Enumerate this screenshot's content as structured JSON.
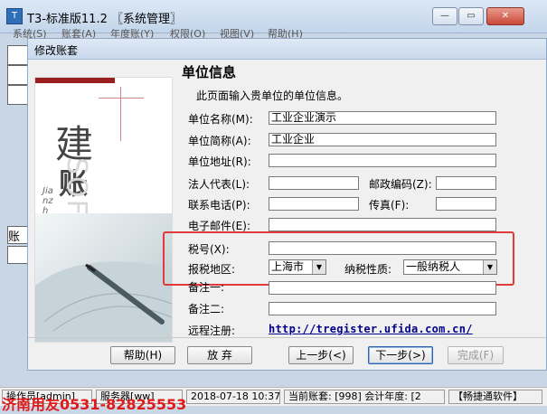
{
  "app": {
    "title": "T3-标准版11.2 〖系统管理〗",
    "icon": "T",
    "window_controls": {
      "minimize": "—",
      "maximize": "▭",
      "close": "✕"
    }
  },
  "menu": [
    {
      "label": "系统(S)"
    },
    {
      "label": "账套(A)"
    },
    {
      "label": "年度账(Y)"
    },
    {
      "label": "权限(O)"
    },
    {
      "label": "视图(V)"
    },
    {
      "label": "帮助(H)"
    }
  ],
  "background": {
    "row_label": "账"
  },
  "dialog": {
    "title": "修改账套",
    "panel": {
      "char1": "建",
      "char2": "账",
      "pinyin": "Jianzhang",
      "soft": "SOF"
    },
    "heading": "单位信息",
    "intro": "此页面输入贵单位的单位信息。",
    "fields": {
      "company_name": {
        "label": "单位名称(M):",
        "value": "工业企业演示"
      },
      "short_name": {
        "label": "单位简称(A):",
        "value": "工业企业"
      },
      "address": {
        "label": "单位地址(R):",
        "value": ""
      },
      "legal_rep": {
        "label": "法人代表(L):",
        "value": ""
      },
      "postcode": {
        "label": "邮政编码(Z):",
        "value": ""
      },
      "phone": {
        "label": "联系电话(P):",
        "value": ""
      },
      "fax": {
        "label": "传真(F):",
        "value": ""
      },
      "email": {
        "label": "电子邮件(E):",
        "value": ""
      },
      "tax_no": {
        "label": "税号(X):",
        "value": ""
      },
      "tax_region": {
        "label": "报税地区:",
        "value": "上海市"
      },
      "taxpayer_type": {
        "label": "纳税性质:",
        "value": "一般纳税人"
      },
      "note1": {
        "label": "备注一:",
        "value": ""
      },
      "note2": {
        "label": "备注二:",
        "value": ""
      },
      "remote_reg": {
        "label": "远程注册:",
        "value": "http://tregister.ufida.com.cn/"
      }
    },
    "buttons": {
      "help": "帮助(H)",
      "discard": "放 弃",
      "prev": "上一步(<)",
      "next": "下一步(>)",
      "finish": "完成(F)"
    }
  },
  "status": {
    "operator": "操作员[admin]",
    "server": "服务器[ww]",
    "datetime": "2018-07-18 10:37",
    "account": "当前账套: [998] 会计年度: [2",
    "company": "【畅捷通软件】"
  },
  "watermark": "济南用友0531-82825553",
  "colors": {
    "highlight": "#e23a3a",
    "link": "#00008b",
    "watermark": "#e01a1a"
  }
}
